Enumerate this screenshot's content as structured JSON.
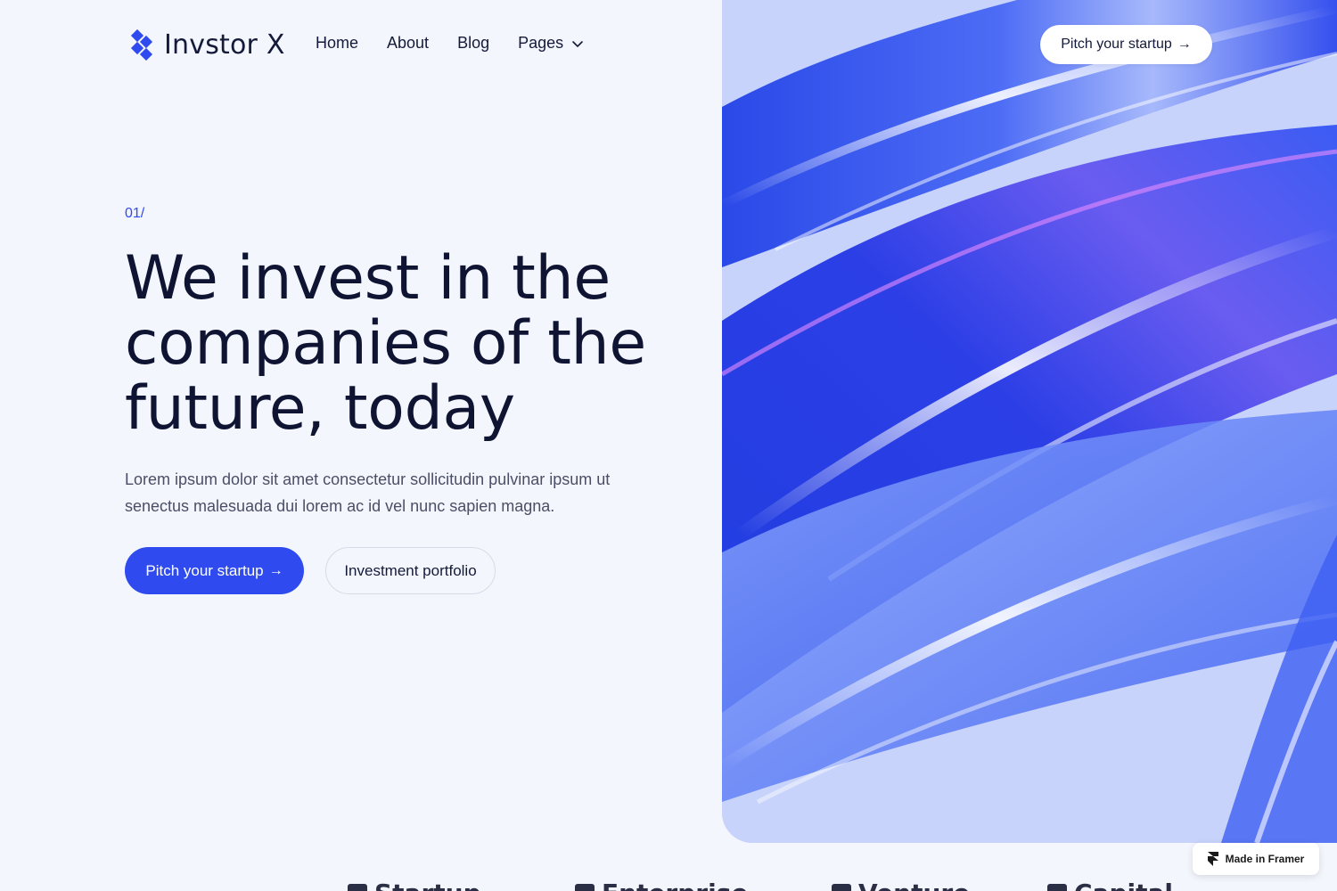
{
  "brand": {
    "name": "Invstor X",
    "accent": "#2f4bf0"
  },
  "nav": {
    "items": [
      {
        "label": "Home"
      },
      {
        "label": "About"
      },
      {
        "label": "Blog"
      },
      {
        "label": "Pages"
      }
    ],
    "cta_label": "Pitch your startup",
    "cta_icon": "arrow-right-icon"
  },
  "hero": {
    "section_number": "01/",
    "title": "We invest in the companies of the future, today",
    "subtitle": "Lorem ipsum dolor sit amet consectetur sollicitudin pulvinar ipsum ut senectus malesuada dui lorem ac id vel nunc sapien magna.",
    "primary_button": "Pitch your startup",
    "secondary_button": "Investment portfolio",
    "image": "abstract-blue-glass-ribbons"
  },
  "logos": {
    "items": [
      {
        "label": "Startup"
      },
      {
        "label": "Enterprise"
      },
      {
        "label": "Venture"
      },
      {
        "label": "Capital"
      }
    ]
  },
  "badge": {
    "label": "Made in Framer"
  },
  "colors": {
    "background": "#f4f6fd",
    "heading": "#0f1433",
    "body_text": "#4a4f66",
    "primary_button": "#2f4bf0"
  }
}
